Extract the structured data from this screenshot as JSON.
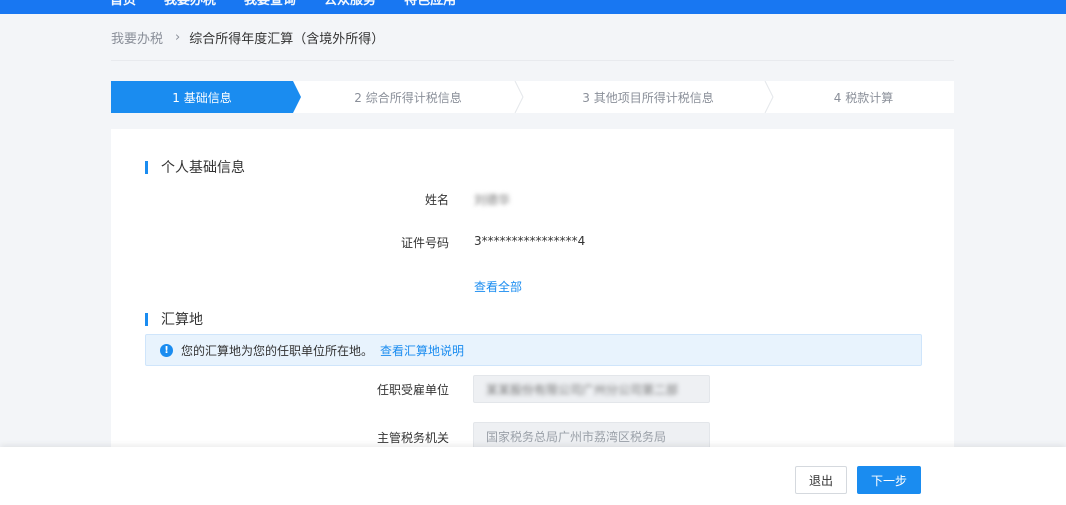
{
  "nav": {
    "items": [
      "首页",
      "我要办税",
      "我要查询",
      "公众服务",
      "特色应用"
    ]
  },
  "breadcrumb": {
    "home": "我要办税",
    "separator": "›",
    "current": "综合所得年度汇算（含境外所得）"
  },
  "steps": [
    {
      "label": "1 基础信息",
      "active": true
    },
    {
      "label": "2 综合所得计税信息",
      "active": false
    },
    {
      "label": "3 其他项目所得计税信息",
      "active": false
    },
    {
      "label": "4 税款计算",
      "active": false
    }
  ],
  "personal": {
    "title": "个人基础信息",
    "name_label": "姓名",
    "name_value": "刘德华",
    "id_label": "证件号码",
    "id_value": "3****************4",
    "view_all": "查看全部"
  },
  "settlement": {
    "title": "汇算地",
    "notice_icon": "!",
    "notice_text": "您的汇算地为您的任职单位所在地。",
    "notice_link": "查看汇算地说明",
    "employer_label": "任职受雇单位",
    "employer_value": "某某股份有限公司广州分公司第二部",
    "tax_office_label": "主管税务机关",
    "tax_office_value": "国家税务总局广州市荔湾区税务局"
  },
  "footer": {
    "exit": "退出",
    "next": "下一步"
  },
  "colors": {
    "primary": "#1a8cf0",
    "topbar": "#1877f2",
    "background": "#f3f5f8"
  }
}
